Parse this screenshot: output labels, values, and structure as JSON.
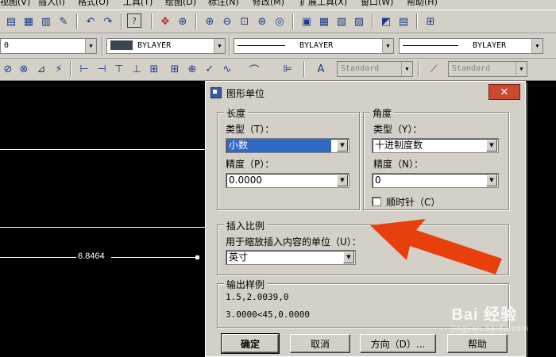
{
  "menu": {
    "items": [
      "视图(V)",
      "插入(I)",
      "格式(O)",
      "工具(T)",
      "绘图(D)",
      "标注(N)",
      "修改(M)",
      "扩展工具(X)",
      "窗口(W)",
      "帮助(H)"
    ]
  },
  "toolbar2": {
    "layer_value": "0",
    "color_value": "BYLAYER",
    "linetype_value": "BYLAYER",
    "lineweight_value": "BYLAYER"
  },
  "toolbar3": {
    "text_style": "Standard",
    "dim_style": "Standard"
  },
  "drawing": {
    "dimension_text": "6.8464"
  },
  "dialog": {
    "title": "图形单位",
    "close_glyph": "✕",
    "length": {
      "group_title": "长度",
      "type_label": "类型（T）：",
      "type_value": "小数",
      "precision_label": "精度（P）：",
      "precision_value": "0.0000"
    },
    "angle": {
      "group_title": "角度",
      "type_label": "类型（Y）：",
      "type_value": "十进制度数",
      "precision_label": "精度（N）：",
      "precision_value": "0",
      "clockwise_label": "顺时针（C）"
    },
    "insert_scale": {
      "group_title": "插入比例",
      "units_label": "用于缩放插入内容的单位（U）：",
      "units_value": "英寸"
    },
    "output_sample": {
      "group_title": "输出样例",
      "line1": "1.5,2.0039,0",
      "line2": "3.0000<45,0.0000"
    },
    "buttons": {
      "ok": "确定",
      "cancel": "取消",
      "direction": "方向（D）...",
      "help": "帮助"
    }
  },
  "watermark": {
    "text": "Bai 经验",
    "sub": "jingyan.baidu.com"
  },
  "colors": {
    "chrome": "#d4d0c8",
    "canvas": "#000000",
    "highlight": "#316ac5",
    "arrow": "#e8400c"
  }
}
